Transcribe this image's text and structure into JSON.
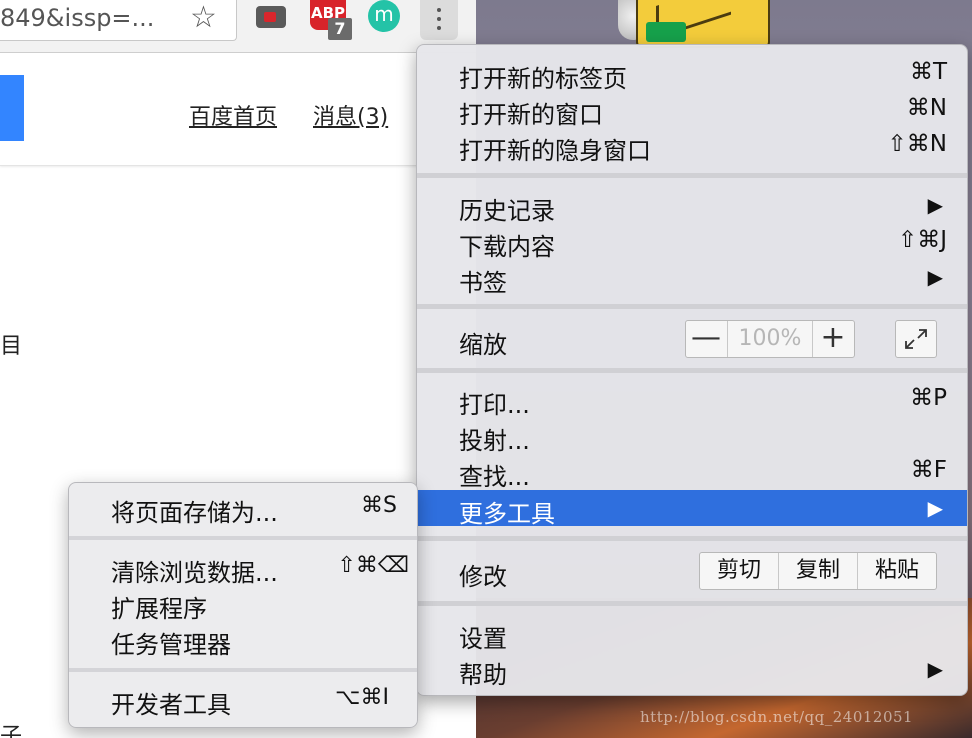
{
  "browser": {
    "url_text": "849&issp=...",
    "abp_label": "ABP",
    "abp_badge": "7",
    "avatar_letter": "m"
  },
  "page": {
    "nav_links": [
      "百度首页",
      "消息(3)"
    ],
    "fragment_1": "目",
    "fragment_2": "子"
  },
  "main_menu": {
    "groups": [
      [
        {
          "label": "打开新的标签页",
          "shortcut": "⌘T"
        },
        {
          "label": "打开新的窗口",
          "shortcut": "⌘N"
        },
        {
          "label": "打开新的隐身窗口",
          "shortcut": "⇧⌘N"
        }
      ],
      [
        {
          "label": "历史记录",
          "arrow": "▶"
        },
        {
          "label": "下载内容",
          "shortcut": "⇧⌘J"
        },
        {
          "label": "书签",
          "arrow": "▶"
        }
      ],
      [
        {
          "label": "缩放"
        }
      ],
      [
        {
          "label": "打印...",
          "shortcut": "⌘P"
        },
        {
          "label": "投射..."
        },
        {
          "label": "查找...",
          "shortcut": "⌘F"
        },
        {
          "label": "更多工具",
          "arrow": "▶",
          "highlighted": true
        }
      ],
      [
        {
          "label": "修改"
        }
      ],
      [
        {
          "label": "设置"
        },
        {
          "label": "帮助",
          "arrow": "▶"
        }
      ]
    ],
    "zoom": {
      "minus": "—",
      "value": "100%",
      "plus": "+"
    },
    "edit": {
      "cut": "剪切",
      "copy": "复制",
      "paste": "粘贴"
    }
  },
  "sub_menu": {
    "items": [
      {
        "label": "将页面存储为...",
        "shortcut": "⌘S"
      },
      {
        "label": "清除浏览数据...",
        "shortcut": "⇧⌘⌫"
      },
      {
        "label": "扩展程序"
      },
      {
        "label": "任务管理器"
      },
      {
        "label": "开发者工具",
        "shortcut": "⌥⌘I"
      }
    ]
  },
  "watermark": "http://blog.csdn.net/qq_24012051",
  "colors": {
    "highlight": "#2f6fde",
    "baidu_blue": "#3385ff",
    "avatar": "#24c3a7",
    "abp_red": "#d8232a"
  }
}
